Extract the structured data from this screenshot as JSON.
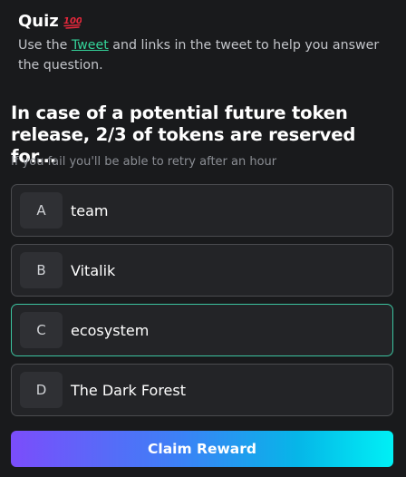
{
  "header": {
    "title": "Quiz",
    "title_icon": "hundred-points-icon",
    "intro_before": "Use the ",
    "intro_link": "Tweet",
    "intro_after": " and links in the tweet to help you answer the question."
  },
  "question": {
    "text": "In case of a potential future token release, 2/3 of tokens are reserved for...",
    "hint": "If you fail you'll be able to retry after an hour"
  },
  "options": [
    {
      "letter": "A",
      "label": "team"
    },
    {
      "letter": "B",
      "label": "Vitalik"
    },
    {
      "letter": "C",
      "label": "ecosystem"
    },
    {
      "letter": "D",
      "label": "The Dark Forest"
    }
  ],
  "selected_option": "C",
  "actions": {
    "claim_label": "Claim Reward"
  },
  "colors": {
    "background": "#191a1c",
    "link": "#34d399",
    "selected_border": "#3cc4a0",
    "button_gradient_start": "#7b4dfb",
    "button_gradient_end": "#00f0f5"
  }
}
